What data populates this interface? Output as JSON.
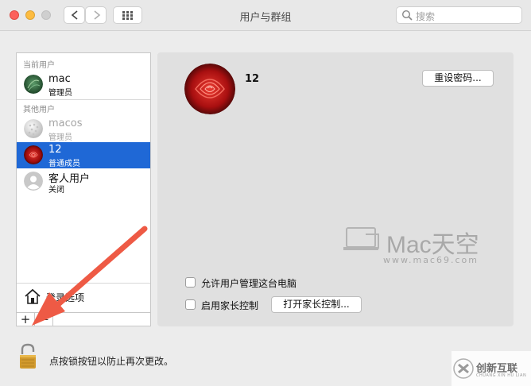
{
  "window": {
    "title": "用户与群组"
  },
  "toolbar": {
    "search_placeholder": "搜索"
  },
  "sidebar": {
    "current_header": "当前用户",
    "other_header": "其他用户",
    "users": [
      {
        "name": "mac",
        "role": "管理员"
      },
      {
        "name": "macos",
        "role": "管理员"
      },
      {
        "name": "12",
        "role": "普通成员"
      },
      {
        "name": "客人用户",
        "role": "关闭"
      }
    ],
    "login_options": "登录选项",
    "add": "+",
    "remove": "—"
  },
  "main": {
    "username": "12",
    "reset_password": "重设密码...",
    "allow_admin": "允许用户管理这台电脑",
    "parental": "启用家长控制",
    "open_parental": "打开家长控制..."
  },
  "watermark": {
    "title": "Mac天空",
    "url": "www.mac69.com"
  },
  "footer": {
    "lock_text": "点按锁按钮以防止再次更改。"
  },
  "brand": {
    "name": "创新互联",
    "sub": "CHUANG XIN HU LIAN"
  },
  "colors": {
    "selection": "#1f68d6",
    "arrow": "#ee5a45"
  }
}
